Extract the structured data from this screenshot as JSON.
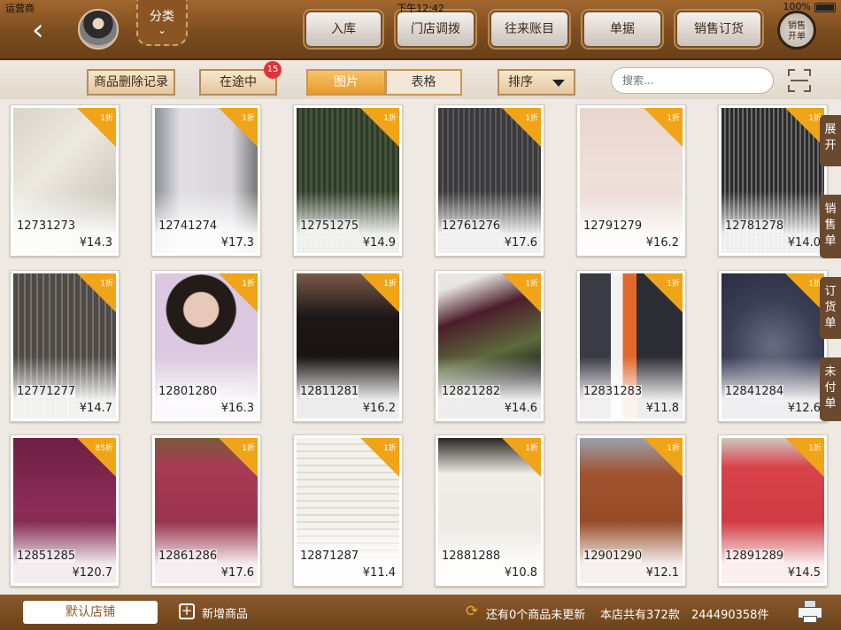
{
  "status_bar": {
    "carrier": "运营商",
    "time": "下午12:42",
    "battery": "100%"
  },
  "header": {
    "category_label": "分类",
    "buttons": [
      "入库",
      "门店调拨",
      "往来账目",
      "单据",
      "销售订货"
    ],
    "round_button": {
      "line1": "销售",
      "line2": "开单"
    }
  },
  "toolbar": {
    "delete_log": "商品删除记录",
    "in_transit": "在途中",
    "in_transit_count": "15",
    "view_picture": "图片",
    "view_table": "表格",
    "sort_label": "排序",
    "search_placeholder": "搜索..."
  },
  "products": [
    {
      "code": "12731273",
      "price": "¥14.3",
      "discount": "1折"
    },
    {
      "code": "12741274",
      "price": "¥17.3",
      "discount": "1折"
    },
    {
      "code": "12751275",
      "price": "¥14.9",
      "discount": "1折"
    },
    {
      "code": "12761276",
      "price": "¥17.6",
      "discount": "1折"
    },
    {
      "code": "12791279",
      "price": "¥16.2",
      "discount": "1折"
    },
    {
      "code": "12781278",
      "price": "¥14.0",
      "discount": "1折"
    },
    {
      "code": "12771277",
      "price": "¥14.7",
      "discount": "1折"
    },
    {
      "code": "12801280",
      "price": "¥16.3",
      "discount": "1折"
    },
    {
      "code": "12811281",
      "price": "¥16.2",
      "discount": "1折"
    },
    {
      "code": "12821282",
      "price": "¥14.6",
      "discount": "1折"
    },
    {
      "code": "12831283",
      "price": "¥11.8",
      "discount": "1折"
    },
    {
      "code": "12841284",
      "price": "¥12.6",
      "discount": "1折"
    },
    {
      "code": "12851285",
      "price": "¥120.7",
      "discount": "85折"
    },
    {
      "code": "12861286",
      "price": "¥17.6",
      "discount": "1折"
    },
    {
      "code": "12871287",
      "price": "¥11.4",
      "discount": "1折"
    },
    {
      "code": "12881288",
      "price": "¥10.8",
      "discount": "1折"
    },
    {
      "code": "12901290",
      "price": "¥12.1",
      "discount": "1折"
    },
    {
      "code": "12891289",
      "price": "¥14.5",
      "discount": "1折"
    }
  ],
  "side_tabs": [
    "展开",
    "销售单",
    "订货单",
    "未付单"
  ],
  "footer": {
    "default_store": "默认店铺",
    "add_product": "新增商品",
    "unsynced": "还有0个商品未更新",
    "store_total": "本店共有372款",
    "item_count": "244490358件"
  },
  "colors": {
    "accent": "#f0a418",
    "header_brown": "#7c4c1e",
    "badge_red": "#e0333a"
  },
  "icons": [
    "back-arrow-icon",
    "avatar-image",
    "chevron-down-icon",
    "scan-icon",
    "add-icon",
    "refresh-icon",
    "printer-icon"
  ]
}
